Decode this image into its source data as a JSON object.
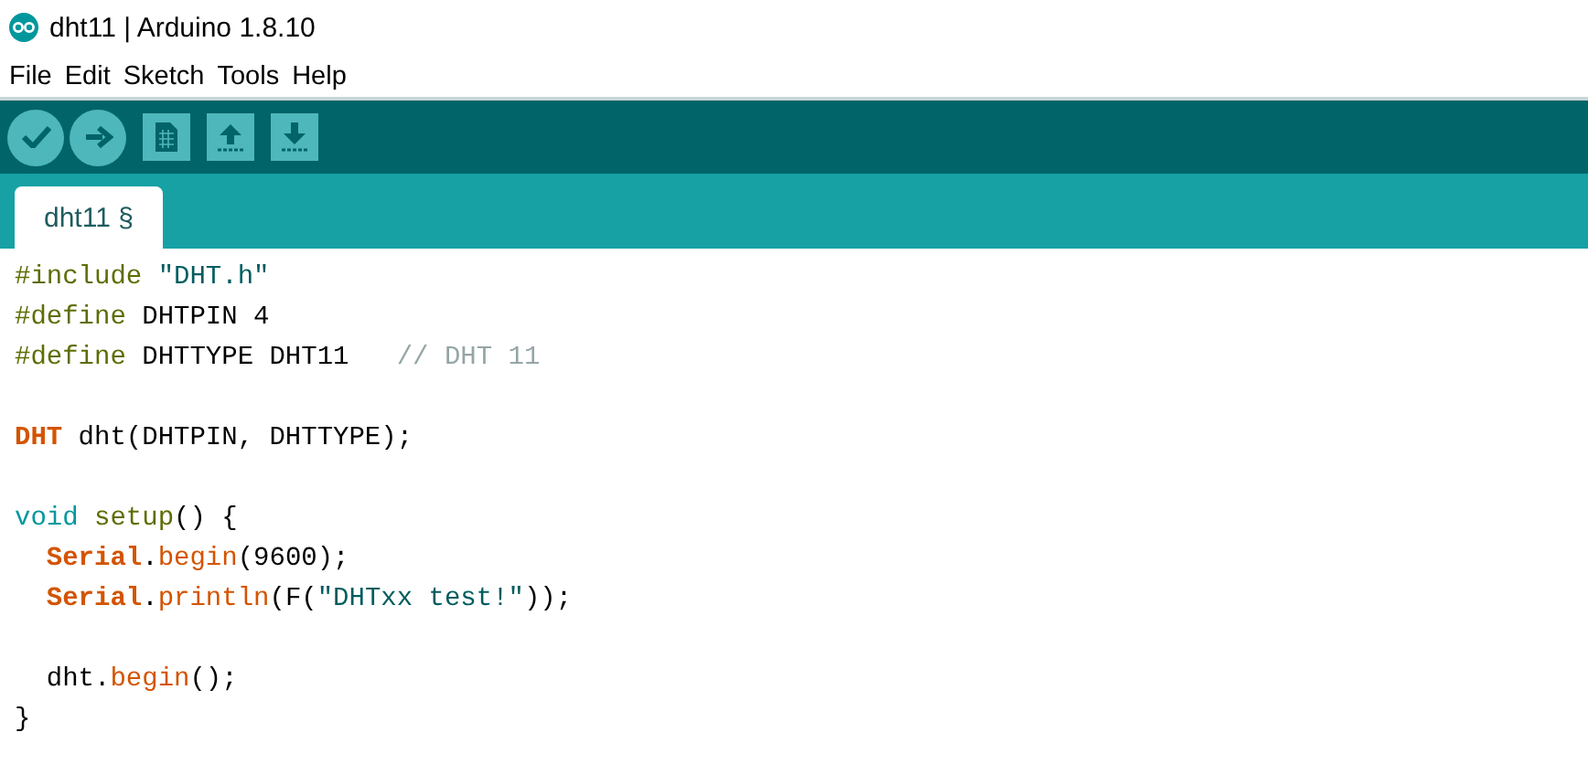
{
  "window": {
    "title": "dht11 | Arduino 1.8.10"
  },
  "menu": [
    "File",
    "Edit",
    "Sketch",
    "Tools",
    "Help"
  ],
  "toolbar": [
    {
      "kind": "verify"
    },
    {
      "kind": "upload"
    },
    {
      "kind": "new"
    },
    {
      "kind": "open"
    },
    {
      "kind": "save"
    }
  ],
  "tabs": [
    {
      "label": "dht11 §",
      "selected": true
    }
  ],
  "code": {
    "blocks": [
      [
        [
          {
            "kind": "directive",
            "text": "#include"
          },
          {
            "kind": "string",
            "text": " \"DHT.h\""
          }
        ],
        [
          {
            "kind": "directive",
            "text": "#define"
          },
          {
            "kind": "plain",
            "text": " DHTPIN 4"
          }
        ],
        [
          {
            "kind": "directive",
            "text": "#define"
          },
          {
            "kind": "plain",
            "text": " DHTTYPE DHT11   "
          },
          {
            "kind": "comment",
            "text": "// DHT 11"
          }
        ]
      ],
      [
        [
          {
            "kind": "type",
            "text": "DHT"
          },
          {
            "kind": "plain",
            "text": " dht(DHTPIN, DHTTYPE);"
          }
        ]
      ],
      [
        [
          {
            "kind": "keyword",
            "text": "void"
          },
          {
            "kind": "directive",
            "text": " setup"
          },
          {
            "kind": "plain",
            "text": "() {"
          }
        ],
        [
          {
            "kind": "type",
            "text": "  Serial"
          },
          {
            "kind": "plain",
            "text": "."
          },
          {
            "kind": "function",
            "text": "begin"
          },
          {
            "kind": "plain",
            "text": "(9600);"
          }
        ],
        [
          {
            "kind": "type",
            "text": "  Serial"
          },
          {
            "kind": "plain",
            "text": "."
          },
          {
            "kind": "function",
            "text": "println"
          },
          {
            "kind": "plain",
            "text": "(F("
          },
          {
            "kind": "string",
            "text": "\"DHTxx test!\""
          },
          {
            "kind": "plain",
            "text": "));"
          }
        ]
      ],
      [
        [
          {
            "kind": "plain",
            "text": "  dht."
          },
          {
            "kind": "function",
            "text": "begin"
          },
          {
            "kind": "plain",
            "text": "();"
          }
        ],
        [
          {
            "kind": "plain",
            "text": "}"
          }
        ]
      ]
    ]
  }
}
